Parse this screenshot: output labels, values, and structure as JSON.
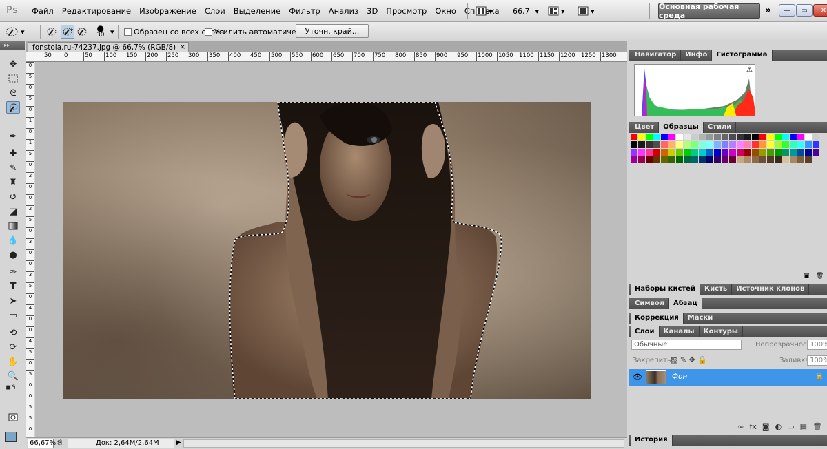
{
  "app": {
    "logo": "Ps"
  },
  "menu": [
    "Файл",
    "Редактирование",
    "Изображение",
    "Слои",
    "Выделение",
    "Фильтр",
    "Анализ",
    "3D",
    "Просмотр",
    "Окно",
    "Справка"
  ],
  "menubar": {
    "zoom": "66,7",
    "workspace": "Основная рабочая среда",
    "chevron": "»"
  },
  "window_controls": {
    "minimize": "—",
    "restore": "▭",
    "close": "✕"
  },
  "options": {
    "brush_size": "30",
    "sample_all_layers": "Образец со всех слоев",
    "auto_enhance": "Усилить автоматически",
    "refine_edge": "Уточн. край..."
  },
  "document": {
    "tab_title": "fonstola.ru-74237.jpg @ 66,7% (RGB/8)",
    "close": "×",
    "ruler_ticks": [
      "50",
      "0",
      "50",
      "100",
      "150",
      "200",
      "250",
      "300",
      "350",
      "400",
      "450",
      "500",
      "550",
      "600",
      "650",
      "700",
      "750",
      "800",
      "850",
      "900",
      "950",
      "1000",
      "1050",
      "1100",
      "1150",
      "1200",
      "1250",
      "1300"
    ],
    "ruler_left_ticks": [
      "0",
      "5",
      "0",
      "5",
      "0",
      "1",
      "0",
      "1",
      "5",
      "0",
      "2",
      "0",
      "0",
      "2",
      "5",
      "0",
      "3",
      "0",
      "0",
      "3",
      "5",
      "0",
      "4",
      "0",
      "0",
      "4",
      "5",
      "0",
      "5",
      "0",
      "0",
      "5",
      "5",
      "0"
    ]
  },
  "status": {
    "zoom": "66,67%",
    "doc_size": "Док: 2,64M/2,64M",
    "arrow": "▶"
  },
  "panels": {
    "top_tabs": [
      "Навигатор",
      "Инфо",
      "Гистограмма"
    ],
    "swatch_tabs": [
      "Цвет",
      "Образцы",
      "Стили"
    ],
    "brush_tabs": [
      "Наборы кистей",
      "Кисть",
      "Источник клонов"
    ],
    "text_tabs": [
      "Символ",
      "Абзац"
    ],
    "adj_tabs": [
      "Коррекция",
      "Маски"
    ],
    "layer_tabs": [
      "Слои",
      "Каналы",
      "Контуры"
    ],
    "history_tab": "История",
    "warning_icon": "⚠"
  },
  "layers": {
    "blend_mode": "Обычные",
    "opacity_label": "Непрозрачность:",
    "opacity_value": "100%",
    "lock_label": "Закрепить:",
    "fill_label": "Заливка:",
    "fill_value": "100%",
    "layer_name": "Фон",
    "footer_icons": [
      "∞",
      "fx",
      "◙",
      "◐",
      "▭",
      "▤",
      "🗑"
    ]
  },
  "swatch_colors": [
    "#ff0000",
    "#ffff00",
    "#00ff00",
    "#00ffff",
    "#0000ff",
    "#ff00ff",
    "#ffffff",
    "#e6e6e6",
    "#cccccc",
    "#b3b3b3",
    "#999999",
    "#808080",
    "#666666",
    "#4d4d4d",
    "#333333",
    "#1a1a1a",
    "#000000",
    "#ff0000",
    "#ffff00",
    "#00ff00",
    "#00ffff",
    "#0000ff",
    "#ff00ff",
    "#ffffff",
    "#cccccc",
    "#000000",
    "#1a1a1a",
    "#333333",
    "#4d4d4d",
    "#ff6666",
    "#ffb366",
    "#ffff80",
    "#b3ff80",
    "#80ff80",
    "#80ffd9",
    "#80ffff",
    "#80b3ff",
    "#8080ff",
    "#b380ff",
    "#ff80ff",
    "#ff80b3",
    "#ff3333",
    "#ff9933",
    "#ffff33",
    "#99ff33",
    "#33ff33",
    "#33ffbb",
    "#33ffff",
    "#3399ff",
    "#3333ff",
    "#9933ff",
    "#ff33ff",
    "#ff3399",
    "#cc0000",
    "#cc6600",
    "#cccc00",
    "#66cc00",
    "#00cc00",
    "#00cc88",
    "#00cccc",
    "#0066cc",
    "#0000cc",
    "#6600cc",
    "#cc00cc",
    "#cc0066",
    "#990000",
    "#994c00",
    "#999900",
    "#4d9900",
    "#009900",
    "#009966",
    "#009999",
    "#004c99",
    "#000099",
    "#4c0099",
    "#990099",
    "#99004c",
    "#660000",
    "#663300",
    "#666600",
    "#336600",
    "#006600",
    "#006644",
    "#006666",
    "#003366",
    "#000066",
    "#330066",
    "#660066",
    "#660033",
    "#c8a882",
    "#b08a62",
    "#8c6a48",
    "#6e5034",
    "#523a24",
    "#3a2818",
    "#d9c0a0",
    "#a88864",
    "#7c5e40",
    "#5a4028"
  ]
}
